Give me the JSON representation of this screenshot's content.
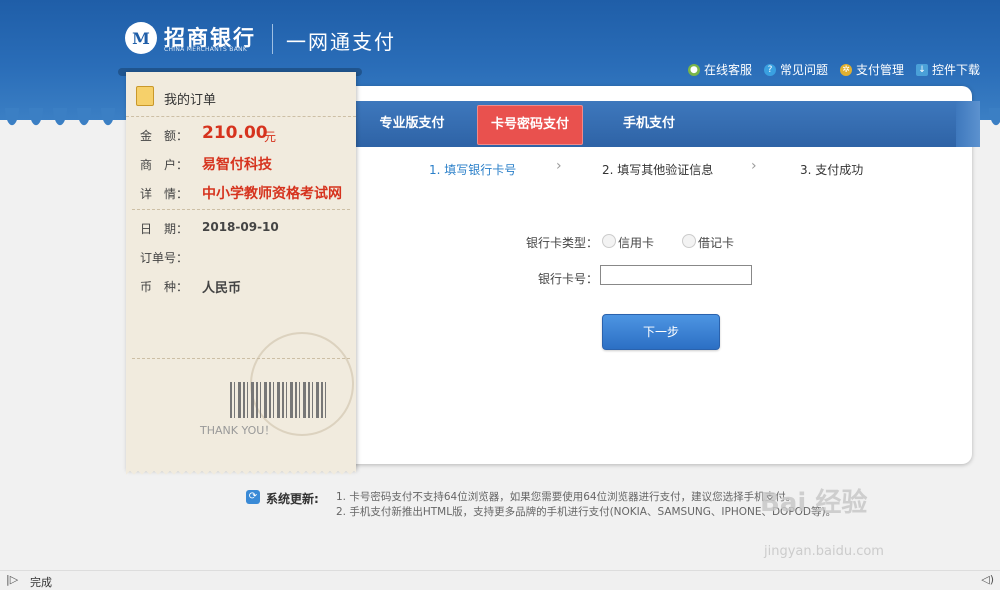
{
  "header": {
    "logo_mark": "M",
    "bank_name_cn": "招商银行",
    "bank_name_en": "CHINA MERCHANTS BANK",
    "service_name": "一网通支付",
    "links": [
      {
        "label": "在线客服",
        "icon": "chat-icon",
        "color": "#7ab648"
      },
      {
        "label": "常见问题",
        "icon": "help-icon",
        "color": "#3aa0e0"
      },
      {
        "label": "支付管理",
        "icon": "gear-icon",
        "color": "#e0b030"
      },
      {
        "label": "控件下载",
        "icon": "download-icon",
        "color": "#4aa0d8"
      }
    ]
  },
  "order": {
    "title": "我的订单",
    "rows": [
      {
        "label": "金　额：",
        "value": "210.00",
        "unit": "元"
      },
      {
        "label": "商　户：",
        "value": "易智付科技"
      },
      {
        "label": "详　情：",
        "value": "中小学教师资格考试网"
      },
      {
        "label": "日　期：",
        "value": "2018-09-10"
      },
      {
        "label": "订单号：",
        "value": ""
      },
      {
        "label": "币　种：",
        "value": "人民币"
      }
    ],
    "thankyou": "THANK YOU！"
  },
  "tabs": [
    {
      "label": "专业版支付",
      "active": false
    },
    {
      "label": "卡号密码支付",
      "active": true
    },
    {
      "label": "手机支付",
      "active": false
    }
  ],
  "steps": [
    {
      "label": "1. 填写银行卡号",
      "current": true
    },
    {
      "label": "2. 填写其他验证信息",
      "current": false
    },
    {
      "label": "3. 支付成功",
      "current": false
    }
  ],
  "step_arrow": "›",
  "form": {
    "card_type_label": "银行卡类型：",
    "card_types": [
      "信用卡",
      "借记卡"
    ],
    "card_number_label": "银行卡号：",
    "card_number_value": "",
    "next_button": "下一步"
  },
  "notice": {
    "icon": "⟳",
    "label": "系统更新:",
    "lines": [
      "1. 卡号密码支付不支持64位浏览器，如果您需要使用64位浏览器进行支付，建议您选择手机支付。",
      "2. 手机支付新推出HTML版，支持更多品牌的手机进行支付(NOKIA、SAMSUNG、IPHONE、DOPOD等)。"
    ]
  },
  "statusbar": {
    "status_text": "完成",
    "left_icon": "|▷",
    "right_icon": "◁)"
  },
  "watermark": {
    "main": "Bai 经验",
    "sub": "jingyan.baidu.com"
  },
  "colors": {
    "brand_blue": "#2a6db8",
    "active_tab": "#e9514e",
    "amount_red": "#d6331e",
    "link_blue": "#2a7fc9"
  }
}
